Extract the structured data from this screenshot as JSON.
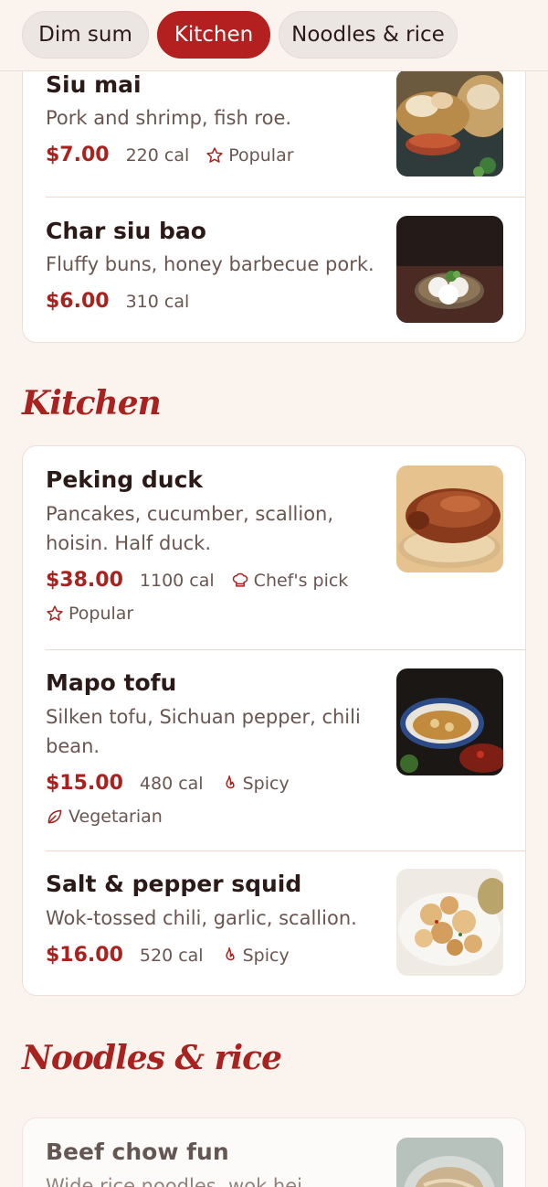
{
  "tabs": [
    {
      "label": "Dim sum",
      "active": false
    },
    {
      "label": "Kitchen",
      "active": true
    },
    {
      "label": "Noodles & rice",
      "active": false
    }
  ],
  "dim_sum": {
    "items": [
      {
        "name": "Siu mai",
        "desc": "Pork and shrimp, fish roe.",
        "price": "$7.00",
        "cal": "220 cal",
        "tags": [
          "Popular"
        ]
      },
      {
        "name": "Char siu bao",
        "desc": "Fluffy buns, honey barbecue pork.",
        "price": "$6.00",
        "cal": "310 cal",
        "tags": []
      }
    ]
  },
  "kitchen": {
    "title": "Kitchen",
    "items": [
      {
        "name": "Peking duck",
        "desc": "Pancakes, cucumber, scallion, hoisin. Half duck.",
        "price": "$38.00",
        "cal": "1100 cal",
        "tags": [
          "Chef's pick",
          "Popular"
        ]
      },
      {
        "name": "Mapo tofu",
        "desc": "Silken tofu, Sichuan pepper, chili bean.",
        "price": "$15.00",
        "cal": "480 cal",
        "tags": [
          "Spicy",
          "Vegetarian"
        ]
      },
      {
        "name": "Salt & pepper squid",
        "desc": "Wok-tossed chili, garlic, scallion.",
        "price": "$16.00",
        "cal": "520 cal",
        "tags": [
          "Spicy"
        ]
      }
    ]
  },
  "noodles": {
    "title": "Noodles & rice",
    "items": [
      {
        "name": "Beef chow fun",
        "desc": "Wide rice noodles, wok hei."
      }
    ]
  },
  "icons": {
    "popular": "star-icon",
    "chefs_pick": "chef-hat-icon",
    "spicy": "flame-icon",
    "vegetarian": "leaf-icon"
  },
  "colors": {
    "accent": "#b3201f",
    "price": "#a8231f",
    "background": "#faf3ee"
  }
}
